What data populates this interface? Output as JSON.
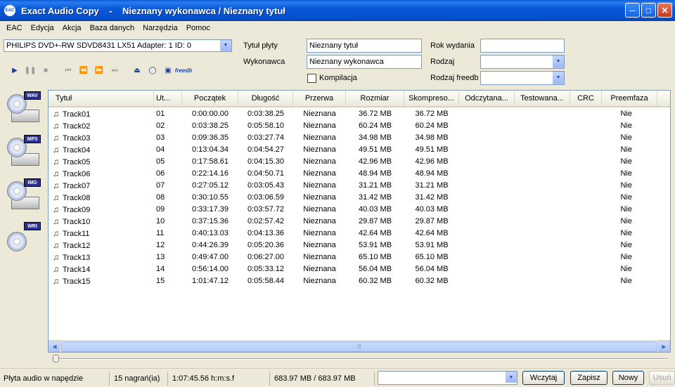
{
  "window": {
    "title": "Exact Audio Copy    -    Nieznany wykonawca / Nieznany tytuł",
    "app_icon": "EAC"
  },
  "menu": [
    "EAC",
    "Edycja",
    "Akcja",
    "Baza danych",
    "Narzędzia",
    "Pomoc"
  ],
  "drive": {
    "selected": "PHILIPS DVD+-RW SDVD8431 LX51   Adapter: 1  ID: 0"
  },
  "toolbar": {
    "freedb_label": "freedb"
  },
  "disc_info": {
    "title_label": "Tytuł płyty",
    "title_value": "Nieznany tytuł",
    "artist_label": "Wykonawca",
    "artist_value": "Nieznany wykonawca",
    "compilation_label": "Kompilacja",
    "year_label": "Rok wydania",
    "year_value": "",
    "genre_label": "Rodzaj",
    "genre_value": "",
    "freedb_genre_label": "Rodzaj freedb",
    "freedb_genre_value": ""
  },
  "sidebar": {
    "wav_tag": "WAV",
    "mp3_tag": "MP3",
    "img_tag": "IMG",
    "wri_tag": "WRI"
  },
  "table": {
    "columns": [
      "Tytuł",
      "Ut...",
      "Początek",
      "Długość",
      "Przerwa",
      "Rozmiar",
      "Skompreso...",
      "Odczytana...",
      "Testowana...",
      "CRC",
      "Preemfaza"
    ],
    "rows": [
      [
        "Track01",
        "01",
        "0:00:00.00",
        "0:03:38.25",
        "Nieznana",
        "36.72 MB",
        "36.72 MB",
        "",
        "",
        "",
        "Nie"
      ],
      [
        "Track02",
        "02",
        "0:03:38.25",
        "0:05:58.10",
        "Nieznana",
        "60.24 MB",
        "60.24 MB",
        "",
        "",
        "",
        "Nie"
      ],
      [
        "Track03",
        "03",
        "0:09:36.35",
        "0:03:27.74",
        "Nieznana",
        "34.98 MB",
        "34.98 MB",
        "",
        "",
        "",
        "Nie"
      ],
      [
        "Track04",
        "04",
        "0:13:04.34",
        "0:04:54.27",
        "Nieznana",
        "49.51 MB",
        "49.51 MB",
        "",
        "",
        "",
        "Nie"
      ],
      [
        "Track05",
        "05",
        "0:17:58.61",
        "0:04:15.30",
        "Nieznana",
        "42.96 MB",
        "42.96 MB",
        "",
        "",
        "",
        "Nie"
      ],
      [
        "Track06",
        "06",
        "0:22:14.16",
        "0:04:50.71",
        "Nieznana",
        "48.94 MB",
        "48.94 MB",
        "",
        "",
        "",
        "Nie"
      ],
      [
        "Track07",
        "07",
        "0:27:05.12",
        "0:03:05.43",
        "Nieznana",
        "31.21 MB",
        "31.21 MB",
        "",
        "",
        "",
        "Nie"
      ],
      [
        "Track08",
        "08",
        "0:30:10.55",
        "0:03:06.59",
        "Nieznana",
        "31.42 MB",
        "31.42 MB",
        "",
        "",
        "",
        "Nie"
      ],
      [
        "Track09",
        "09",
        "0:33:17.39",
        "0:03:57.72",
        "Nieznana",
        "40.03 MB",
        "40.03 MB",
        "",
        "",
        "",
        "Nie"
      ],
      [
        "Track10",
        "10",
        "0:37:15.36",
        "0:02:57.42",
        "Nieznana",
        "29.87 MB",
        "29.87 MB",
        "",
        "",
        "",
        "Nie"
      ],
      [
        "Track11",
        "11",
        "0:40:13.03",
        "0:04:13.36",
        "Nieznana",
        "42.64 MB",
        "42.64 MB",
        "",
        "",
        "",
        "Nie"
      ],
      [
        "Track12",
        "12",
        "0:44:26.39",
        "0:05:20.36",
        "Nieznana",
        "53.91 MB",
        "53.91 MB",
        "",
        "",
        "",
        "Nie"
      ],
      [
        "Track13",
        "13",
        "0:49:47.00",
        "0:06:27.00",
        "Nieznana",
        "65.10 MB",
        "65.10 MB",
        "",
        "",
        "",
        "Nie"
      ],
      [
        "Track14",
        "14",
        "0:56:14.00",
        "0:05:33.12",
        "Nieznana",
        "56.04 MB",
        "56.04 MB",
        "",
        "",
        "",
        "Nie"
      ],
      [
        "Track15",
        "15",
        "1:01:47.12",
        "0:05:58.44",
        "Nieznana",
        "60.32 MB",
        "60.32 MB",
        "",
        "",
        "",
        "Nie"
      ]
    ]
  },
  "statusbar": {
    "disc_status": "Płyta audio w napędzie",
    "track_count": "15 nagrań(ia)",
    "total_time": "1:07:45.56 h:m:s.f",
    "total_size": "683.97 MB / 683.97 MB",
    "buttons": {
      "load": "Wczytaj",
      "save": "Zapisz",
      "new": "Nowy",
      "delete": "Usuń"
    }
  },
  "colors": {
    "titlebar": "#0a58d8",
    "face": "#ece9d8",
    "border": "#7f9db9"
  }
}
